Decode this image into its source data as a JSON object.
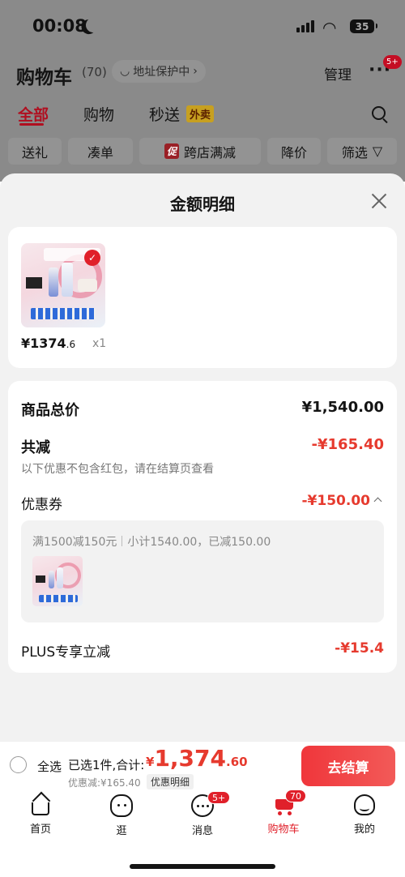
{
  "status": {
    "time": "00:08",
    "battery": "35"
  },
  "header": {
    "title": "购物车",
    "count": "(70)",
    "address": "地址保护中",
    "manage": "管理",
    "more_badge": "5+"
  },
  "tabs": [
    {
      "label": "全部"
    },
    {
      "label": "购物"
    },
    {
      "label": "秒送"
    }
  ],
  "waimai": "外卖",
  "chips": [
    {
      "label": "送礼"
    },
    {
      "label": "凑单"
    },
    {
      "label": "跨店满减",
      "badge": "促"
    },
    {
      "label": "降价"
    },
    {
      "label": "筛选"
    }
  ],
  "sheet": {
    "title": "金额明细",
    "product": {
      "price": "¥1374",
      "price_dec": ".6",
      "qty": "x1"
    },
    "total_label": "商品总价",
    "total_value": "¥1,540.00",
    "discount_label": "共减",
    "discount_value": "-¥165.40",
    "discount_note": "以下优惠不包含红包，请在结算页查看",
    "coupon_label": "优惠券",
    "coupon_value": "-¥150.00",
    "coupon_rule": "满1500减150元",
    "coupon_detail": "小计1540.00，已减150.00",
    "plus_label": "PLUS专享立减",
    "plus_value": "-¥15.4"
  },
  "bottom": {
    "select_all": "全选",
    "selected": "已选1件,合计:",
    "currency": "¥",
    "total_int": "1,374",
    "total_dec": ".60",
    "discount_line": "优惠减:¥165.40",
    "detail_tag": "优惠明细",
    "checkout": "去结算"
  },
  "nav": [
    {
      "label": "首页"
    },
    {
      "label": "逛"
    },
    {
      "label": "消息",
      "badge": "5+"
    },
    {
      "label": "购物车",
      "badge": "70"
    },
    {
      "label": "我的"
    }
  ],
  "colors": {
    "accent": "#e0202a",
    "price_red": "#e63a2e"
  }
}
